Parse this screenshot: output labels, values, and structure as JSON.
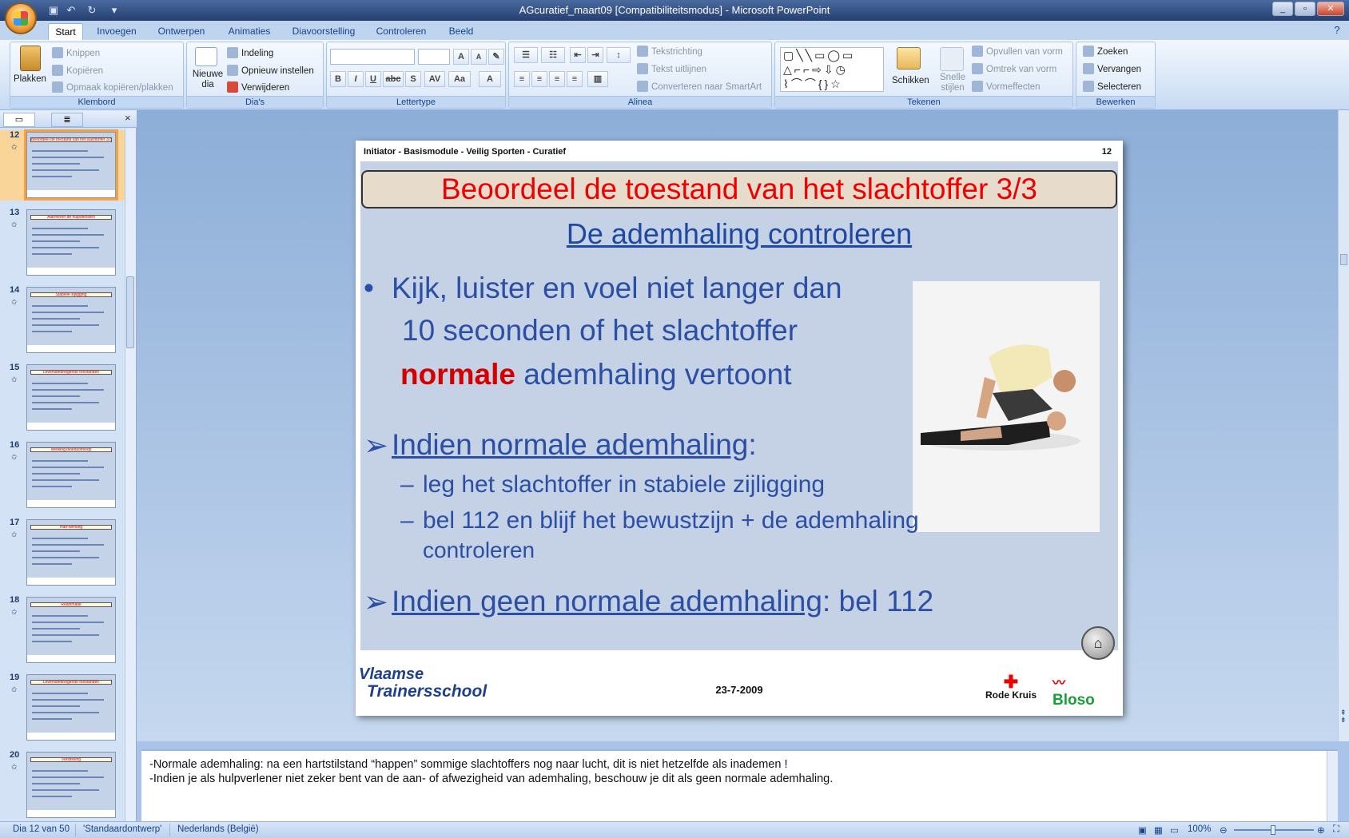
{
  "window": {
    "title": "AGcuratief_maart09 [Compatibiliteitsmodus] - Microsoft PowerPoint"
  },
  "tabs": [
    "Start",
    "Invoegen",
    "Ontwerpen",
    "Animaties",
    "Diavoorstelling",
    "Controleren",
    "Beeld"
  ],
  "ribbon": {
    "klembord": {
      "label": "Klembord",
      "plakken": "Plakken",
      "knippen": "Knippen",
      "kopieren": "Kopiëren",
      "opmaak": "Opmaak kopiëren/plakken"
    },
    "dias": {
      "label": "Dia's",
      "nieuwe_dia": "Nieuwe dia",
      "indeling": "Indeling",
      "opnieuw": "Opnieuw instellen",
      "verwijderen": "Verwijderen"
    },
    "lettertype": {
      "label": "Lettertype",
      "font": "",
      "size": "",
      "bold": "B",
      "italic": "I",
      "underline": "U",
      "strike": "abc",
      "shadow": "S",
      "spacing": "AV",
      "case": "Aa",
      "color": "A",
      "grow": "A",
      "shrink": "A"
    },
    "alinea": {
      "label": "Alinea",
      "tekstrichting": "Tekstrichting",
      "uitlijnen": "Tekst uitlijnen",
      "smartart": "Converteren naar SmartArt"
    },
    "tekenen": {
      "label": "Tekenen",
      "schikken": "Schikken",
      "snelle_stijlen": "Snelle stijlen",
      "opvullen": "Opvullen van vorm",
      "omtrek": "Omtrek van vorm",
      "vormeffecten": "Vormeffecten"
    },
    "bewerken": {
      "label": "Bewerken",
      "zoeken": "Zoeken",
      "vervangen": "Vervangen",
      "selecteren": "Selecteren"
    }
  },
  "thumbnails": [
    {
      "num": "12",
      "title": "Beoordeel de toestand van het slachtoffer 3/3",
      "selected": true
    },
    {
      "num": "13",
      "title": "Alarmeren de hulpdiensten",
      "selected": false
    },
    {
      "num": "14",
      "title": "Stabiele zijligging",
      "selected": false
    },
    {
      "num": "15",
      "title": "Levensbedreigende toestanden",
      "selected": false
    },
    {
      "num": "16",
      "title": "Werking bloedsomloop",
      "selected": false
    },
    {
      "num": "17",
      "title": "Hart-werking",
      "selected": false
    },
    {
      "num": "18",
      "title": "Reanimatie",
      "selected": false
    },
    {
      "num": "19",
      "title": "Levensbedreigende toestanden",
      "selected": false
    },
    {
      "num": "20",
      "title": "Verstikking",
      "selected": false
    }
  ],
  "slide": {
    "header": "Initiator - Basismodule - Veilig  Sporten - Curatief",
    "number": "12",
    "title": "Beoordeel de toestand van het slachtoffer 3/3",
    "subtitle": "De ademhaling controleren",
    "bullet_mark": "•",
    "bullet_line1": "Kijk, luister en voel niet langer dan",
    "bullet_line2": "10 seconden  of het slachtoffer",
    "bullet_normale": "normale",
    "bullet_line3_rest": " ademhaling vertoont",
    "arrow": "➢",
    "indien_normale": "Indien normale ademhaling",
    "colon": ":",
    "dash": "–",
    "sub1": "leg het slachtoffer  in stabiele zijligging",
    "sub2": "bel 112  en blijf het bewustzijn + de ademhaling",
    "sub2b": "controleren",
    "indien_geen": "Indien geen normale ademhaling",
    "geen_rest": ": bel 112",
    "date": "23-7-2009",
    "logo_vt_line1": "Vlaamse",
    "logo_vt_line2": "Trainersschool",
    "logo_rk": "Rode Kruis",
    "logo_bloso": "Bloso"
  },
  "notes": {
    "line1": "-Normale ademhaling: na een hartstilstand “happen” sommige slachtoffers nog naar lucht, dit is niet hetzelfde als inademen !",
    "line2": "-Indien je als hulpverlener niet zeker bent van de aan- of afwezigheid van ademhaling, beschouw je dit als geen normale ademhaling."
  },
  "status": {
    "slide": "Dia 12 van 50",
    "theme": "'Standaardontwerp'",
    "language": "Nederlands (België)",
    "zoom": "100%"
  },
  "colors": {
    "title_red": "#e00000",
    "slide_blue": "#2b4fa5",
    "ribbon_blue": "#15428b",
    "selection_orange": "#f7a13e"
  }
}
